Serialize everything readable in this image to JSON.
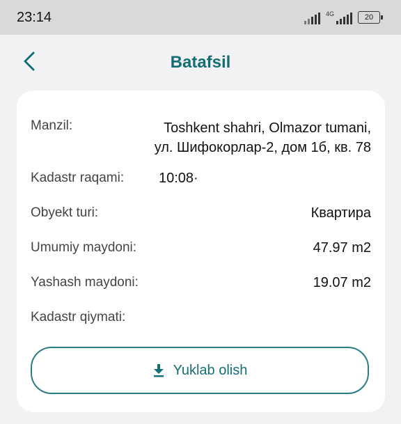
{
  "status_bar": {
    "time": "23:14",
    "network_label": "4G",
    "battery": "20"
  },
  "header": {
    "title": "Batafsil",
    "back_icon": "chevron-left-icon"
  },
  "details": {
    "address_label": "Manzil:",
    "address_line1": "Toshkent shahri, Olmazor tumani,",
    "address_line2": "ул. Шифокорлар-2, дом 1б, кв. 78",
    "cadastral_number_label": "Kadastr raqami:",
    "cadastral_number_value": "10:08·",
    "object_type_label": "Obyekt turi:",
    "object_type_value": "Квартира",
    "total_area_label": "Umumiy maydoni:",
    "total_area_value": "47.97 m2",
    "living_area_label": "Yashash maydoni:",
    "living_area_value": "19.07 m2",
    "cadastral_value_label": "Kadastr qiymati:",
    "cadastral_value_value": ""
  },
  "download": {
    "label": "Yuklab olish",
    "icon": "download-icon"
  },
  "colors": {
    "accent": "#146e75",
    "background": "#f2f2f4",
    "status_bar": "#d9d9d9"
  }
}
